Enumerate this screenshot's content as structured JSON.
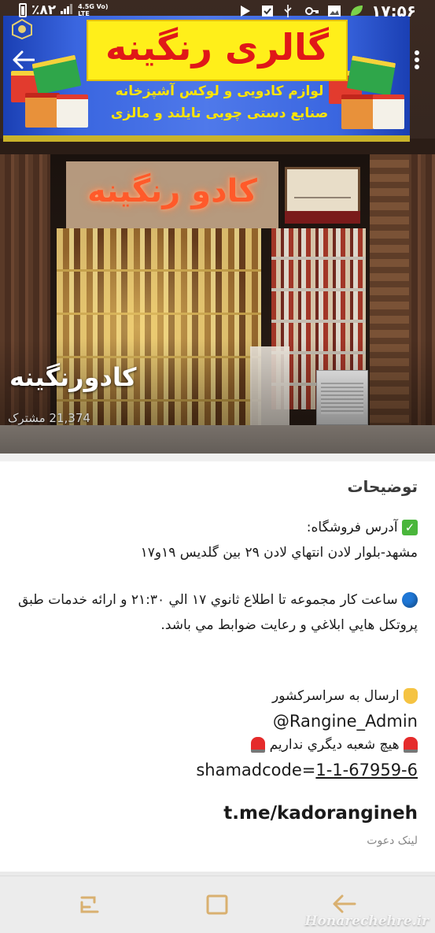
{
  "status_bar": {
    "battery_percent": "٪۸۲",
    "network_top": "4.5G Vo)",
    "network_bottom": "LTE",
    "time": "۱۷:۵۶"
  },
  "header": {
    "back_icon": "arrow-left-icon",
    "more_icon": "more-vertical-icon"
  },
  "hero": {
    "sign_title": "گالری رنگینه",
    "sign_line1": "لوازم کادویی و لوکس آشپزخانه",
    "sign_line2": "صنایع دستی چوبی تایلند و مالزی",
    "neon_text": "کادو رنگینه"
  },
  "channel": {
    "name": "کادورنگینه",
    "subscribers": "21,374 مشترک"
  },
  "description": {
    "title": "توضیحات",
    "address_label": "آدرس فروشگاه:",
    "address": "مشهد-بلوار لادن انتهاي لادن ۲۹ بين گلديس ۱۹و۱۷",
    "hours": "ساعت كار مجموعه تا اطلاع ثانوي ۱۷ الي ۲۱:۳۰ و ارائه خدمات طبق پروتكل هايي ابلاغي و رعايت ضوابط مي باشد.",
    "shipping": "ارسال به سراسرکشور",
    "admin_handle": "@Rangine_Admin",
    "no_branch": "هيچ شعبه ديگري نداريم",
    "shamad_prefix": "shamadcode=",
    "shamad_code": "1-1-67959-6"
  },
  "invite": {
    "link": "t.me/kadorangineh",
    "caption": "لینک دعوت"
  },
  "navbar": {
    "recent_icon": "recent-apps-icon",
    "home_icon": "home-square-icon",
    "back_icon": "nav-back-icon"
  },
  "watermark": "Honarechehre.ir"
}
